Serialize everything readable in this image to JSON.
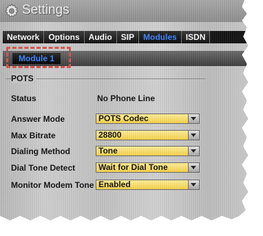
{
  "window": {
    "title": "Settings",
    "icon": "gear-icon"
  },
  "tabs": [
    {
      "label": "Network",
      "active": false
    },
    {
      "label": "Options",
      "active": false
    },
    {
      "label": "Audio",
      "active": false
    },
    {
      "label": "SIP",
      "active": false
    },
    {
      "label": "Modules",
      "active": true
    },
    {
      "label": "ISDN",
      "active": false
    }
  ],
  "subtabs": [
    {
      "label": "Module 1",
      "active": true
    }
  ],
  "group": {
    "title": "POTS"
  },
  "fields": {
    "status": {
      "label": "Status",
      "value": "No Phone Line"
    },
    "answer_mode": {
      "label": "Answer Mode",
      "value": "POTS Codec"
    },
    "max_bitrate": {
      "label": "Max Bitrate",
      "value": "28800"
    },
    "dialing_method": {
      "label": "Dialing Method",
      "value": "Tone"
    },
    "dial_tone_detect": {
      "label": "Dial Tone Detect",
      "value": "Wait for Dial Tone"
    },
    "monitor_modem_tone": {
      "label": "Monitor Modem Tone",
      "value": "Enabled"
    }
  },
  "colors": {
    "active_tab": "#3a86ff",
    "select_fill": "#f7d24a",
    "highlight_dashes": "#d9534f"
  }
}
